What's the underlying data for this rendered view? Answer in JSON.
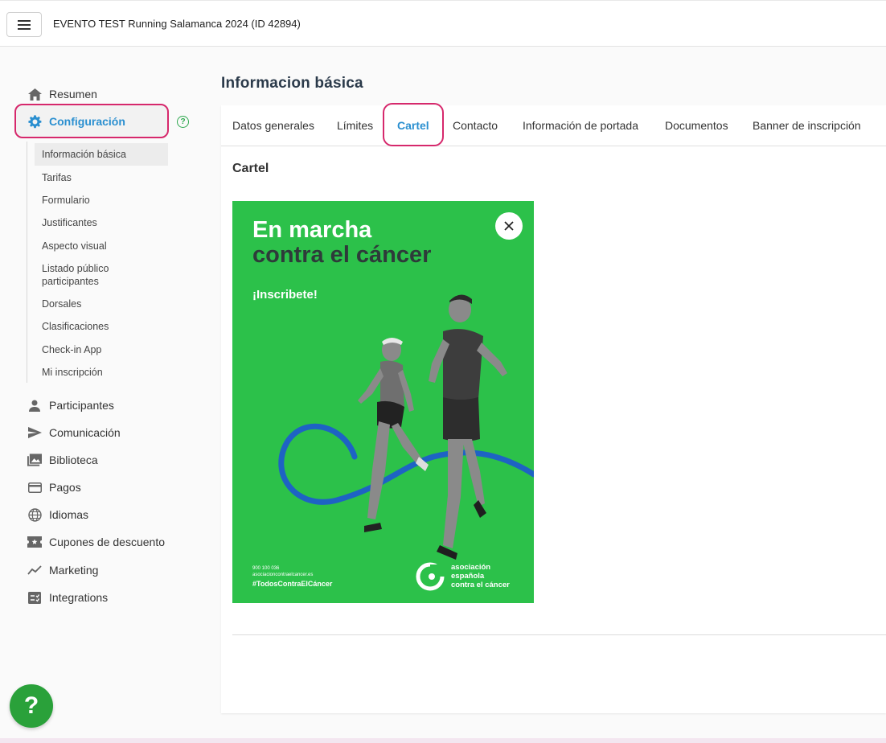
{
  "header": {
    "menu_icon": "hamburger-icon",
    "event_title": "EVENTO TEST Running Salamanca 2024 (ID 42894)"
  },
  "sidebar": {
    "items": [
      {
        "label": "Resumen",
        "icon": "home-icon"
      },
      {
        "label": "Configuración",
        "icon": "gear-icon"
      },
      {
        "label": "Participantes",
        "icon": "person-icon"
      },
      {
        "label": "Comunicación",
        "icon": "send-icon"
      },
      {
        "label": "Biblioteca",
        "icon": "photo-library-icon"
      },
      {
        "label": "Pagos",
        "icon": "credit-card-icon"
      },
      {
        "label": "Idiomas",
        "icon": "globe-icon"
      },
      {
        "label": "Cupones de descuento",
        "icon": "coupon-icon"
      },
      {
        "label": "Marketing",
        "icon": "trending-icon"
      },
      {
        "label": "Integrations",
        "icon": "integrations-icon"
      }
    ],
    "help_icon": "help-circle-icon",
    "sub_items": [
      "Información básica",
      "Tarifas",
      "Formulario",
      "Justificantes",
      "Aspecto visual",
      "Listado público participantes",
      "Dorsales",
      "Clasificaciones",
      "Check-in App",
      "Mi inscripción"
    ],
    "active_sub_item": "Información básica"
  },
  "main": {
    "page_title": "Informacion básica",
    "tabs": [
      {
        "label": "Datos generales"
      },
      {
        "label": "Límites"
      },
      {
        "label": "Cartel"
      },
      {
        "label": "Contacto"
      },
      {
        "label": "Información de portada"
      },
      {
        "label": "Documentos"
      },
      {
        "label": "Banner de inscripción"
      }
    ],
    "active_tab": "Cartel",
    "section_title": "Cartel",
    "poster": {
      "headline_1": "En marcha",
      "headline_2": "contra el cáncer",
      "cta": "¡Inscribete!",
      "phone": "900 100 036",
      "website": "asociacioncontraelcancer.es",
      "hashtag": "#TodosContraElCáncer",
      "logo_line_1": "asociación",
      "logo_line_2": "española",
      "logo_line_3": "contra el cáncer",
      "close_icon": "close-icon",
      "colors": {
        "background": "#2cc14a",
        "dark_text": "#2e3b3a",
        "ribbon": "#1e63c4"
      }
    }
  },
  "help_button": {
    "label": "?"
  },
  "colors": {
    "accent": "#2a8fd0",
    "highlight": "#d6286c",
    "help": "#2aa13a"
  }
}
